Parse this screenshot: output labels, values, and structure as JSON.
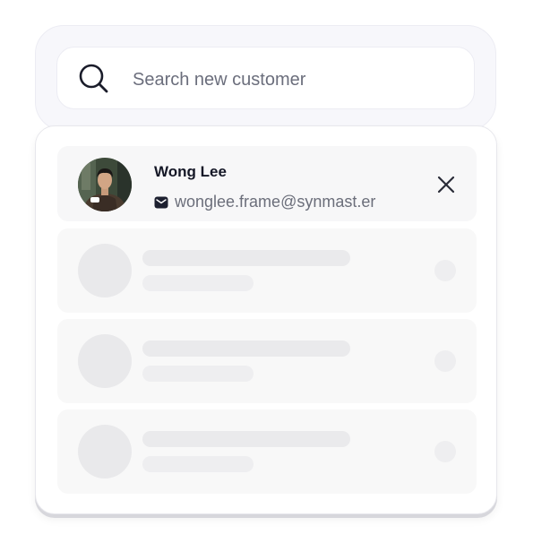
{
  "search": {
    "placeholder": "Search new customer",
    "icon": "search-icon"
  },
  "selected_customer": {
    "name": "Wong Lee",
    "email": "wonglee.frame@synmast.er",
    "email_icon": "mail-icon",
    "remove_icon": "close-icon"
  },
  "loading_rows": [
    {
      "state": "loading"
    },
    {
      "state": "loading"
    },
    {
      "state": "loading"
    }
  ],
  "colors": {
    "text_primary": "#141726",
    "text_secondary": "#6b6e7a",
    "skeleton": "#eaeaec",
    "panel_bg": "#f7f7fb"
  }
}
